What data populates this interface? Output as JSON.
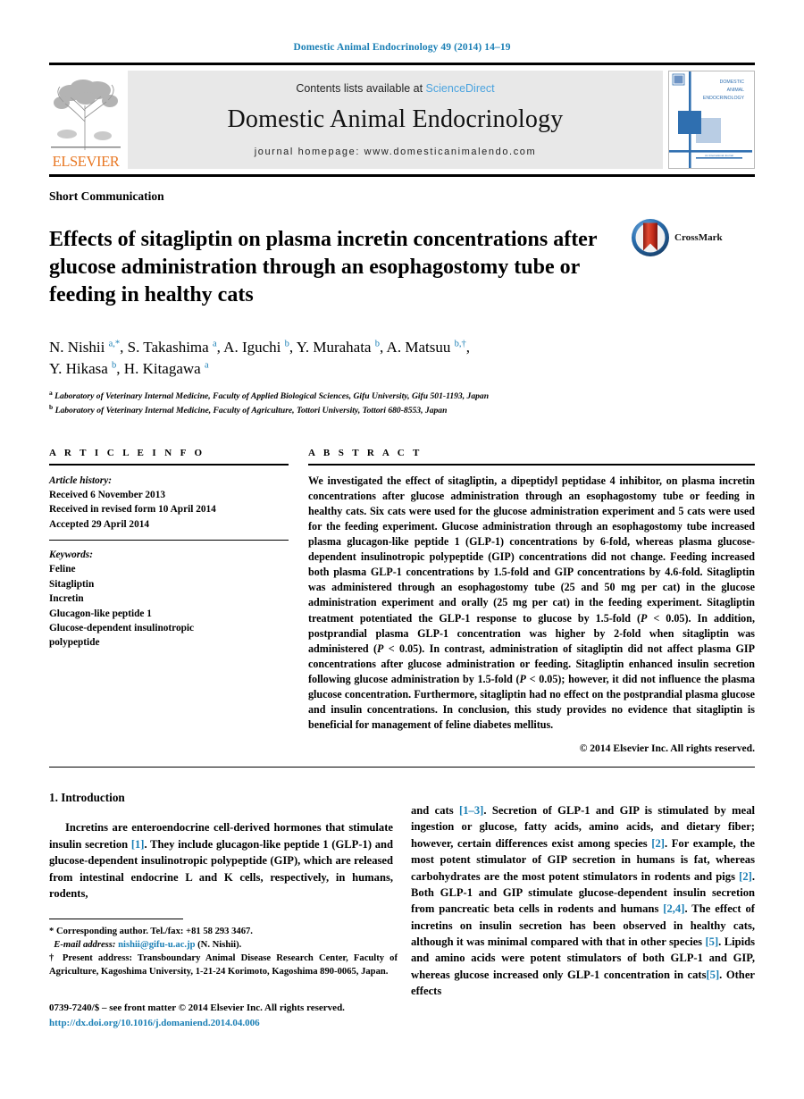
{
  "running_head": "Domestic Animal Endocrinology 49 (2014) 14–19",
  "masthead": {
    "contents_prefix": "Contents lists available at ",
    "sciencedirect": "ScienceDirect",
    "journal_title": "Domestic Animal Endocrinology",
    "homepage": "journal homepage: www.domesticanimalendo.com",
    "publisher": "ELSEVIER",
    "cover_title_lines": [
      "DOMESTIC",
      "ANIMAL",
      "ENDOCRINOLOGY"
    ]
  },
  "article": {
    "type": "Short Communication",
    "title": "Effects of sitagliptin on plasma incretin concentrations after glucose administration through an esophagostomy tube or feeding in healthy cats",
    "crossmark_label": "CrossMark",
    "authors_line1_parts": [
      {
        "name": "N. Nishii ",
        "sup": "a,*"
      },
      {
        "name": ", S. Takashima ",
        "sup": "a"
      },
      {
        "name": ", A. Iguchi ",
        "sup": "b"
      },
      {
        "name": ", Y. Murahata ",
        "sup": "b"
      },
      {
        "name": ", A. Matsuu ",
        "sup": "b,†"
      },
      {
        "name": ",",
        "sup": ""
      }
    ],
    "authors_line2_parts": [
      {
        "name": "Y. Hikasa ",
        "sup": "b"
      },
      {
        "name": ", H. Kitagawa ",
        "sup": "a"
      }
    ],
    "affiliations": [
      {
        "mark": "a",
        "text": "Laboratory of Veterinary Internal Medicine, Faculty of Applied Biological Sciences, Gifu University, Gifu 501-1193, Japan"
      },
      {
        "mark": "b",
        "text": "Laboratory of Veterinary Internal Medicine, Faculty of Agriculture, Tottori University, Tottori 680-8553, Japan"
      }
    ]
  },
  "article_info": {
    "heading": "A R T I C L E   I N F O",
    "history_label": "Article history:",
    "history": [
      "Received 6 November 2013",
      "Received in revised form 10 April 2014",
      "Accepted 29 April 2014"
    ],
    "keywords_label": "Keywords:",
    "keywords": [
      "Feline",
      "Sitagliptin",
      "Incretin",
      "Glucagon-like peptide 1",
      "Glucose-dependent insulinotropic",
      "polypeptide"
    ]
  },
  "abstract": {
    "heading": "A B S T R A C T",
    "text_before_p1": "We investigated the effect of sitagliptin, a dipeptidyl peptidase 4 inhibitor, on plasma incretin concentrations after glucose administration through an esophagostomy tube or feeding in healthy cats. Six cats were used for the glucose administration experiment and 5 cats were used for the feeding experiment. Glucose administration through an esophagostomy tube increased plasma glucagon-like peptide 1 (GLP-1) concentrations by 6-fold, whereas plasma glucose-dependent insulinotropic polypeptide (GIP) concentrations did not change. Feeding increased both plasma GLP-1 concentrations by 1.5-fold and GIP concentrations by 4.6-fold. Sitagliptin was administered through an esophagostomy tube (25 and 50 mg per cat) in the glucose administration experiment and orally (25 mg per cat) in the feeding experiment. Sitagliptin treatment potentiated the GLP-1 response to glucose by 1.5-fold (",
    "p1": "P",
    "text_mid1": " < 0.05). In addition, postprandial plasma GLP-1 concentration was higher by 2-fold when sitagliptin was administered (",
    "p2": "P",
    "text_mid2": " < 0.05). In contrast, administration of sitagliptin did not affect plasma GIP concentrations after glucose administration or feeding. Sitagliptin enhanced insulin secretion following glucose administration by 1.5-fold (",
    "p3": "P",
    "text_end": " < 0.05); however, it did not influence the plasma glucose concentration. Furthermore, sitagliptin had no effect on the postprandial plasma glucose and insulin concentrations. In conclusion, this study provides no evidence that sitagliptin is beneficial for management of feline diabetes mellitus.",
    "copyright": "© 2014 Elsevier Inc. All rights reserved."
  },
  "body": {
    "section_heading": "1. Introduction",
    "left_para_a": "Incretins are enteroendocrine cell-derived hormones that stimulate insulin secretion ",
    "left_ref1": "[1]",
    "left_para_b": ". They include glucagon-like peptide 1 (GLP-1) and glucose-dependent insulinotropic polypeptide (GIP), which are released from intestinal endocrine L and K cells, respectively, in humans, rodents,",
    "right_chunks": [
      {
        "t": "and cats ",
        "ref": false
      },
      {
        "t": "[1–3]",
        "ref": true
      },
      {
        "t": ". Secretion of GLP-1 and GIP is stimulated by meal ingestion or glucose, fatty acids, amino acids, and dietary fiber; however, certain differences exist among species ",
        "ref": false
      },
      {
        "t": "[2]",
        "ref": true
      },
      {
        "t": ". For example, the most potent stimulator of GIP secretion in humans is fat, whereas carbohydrates are the most potent stimulators in rodents and pigs ",
        "ref": false
      },
      {
        "t": "[2]",
        "ref": true
      },
      {
        "t": ". Both GLP-1 and GIP stimulate glucose-dependent insulin secretion from pancreatic beta cells in rodents and humans ",
        "ref": false
      },
      {
        "t": "[2,4]",
        "ref": true
      },
      {
        "t": ". The effect of incretins on insulin secretion has been observed in healthy cats, although it was minimal compared with that in other species ",
        "ref": false
      },
      {
        "t": "[5]",
        "ref": true
      },
      {
        "t": ". Lipids and amino acids were potent stimulators of both GLP-1 and GIP, whereas glucose increased only GLP-1 concentration in cats",
        "ref": false
      },
      {
        "t": "[5]",
        "ref": true
      },
      {
        "t": ". Other effects",
        "ref": false
      }
    ]
  },
  "footnotes": {
    "corresponding": "* Corresponding author. Tel./fax: +81 58 293 3467.",
    "email_label": "E-mail address:",
    "email": "nishii@gifu-u.ac.jp",
    "email_suffix": " (N. Nishii).",
    "present_address": "† Present address: Transboundary Animal Disease Research Center, Faculty of Agriculture, Kagoshima University, 1-21-24 Korimoto, Kagoshima 890-0065, Japan.",
    "issn_line": "0739-7240/$ – see front matter © 2014 Elsevier Inc. All rights reserved.",
    "doi": "http://dx.doi.org/10.1016/j.domaniend.2014.04.006"
  },
  "colors": {
    "link_blue": "#1a7fb5",
    "sciencedirect_blue": "#4aa3df",
    "elsevier_orange": "#e87722",
    "band_gray": "#e8e8e8"
  }
}
